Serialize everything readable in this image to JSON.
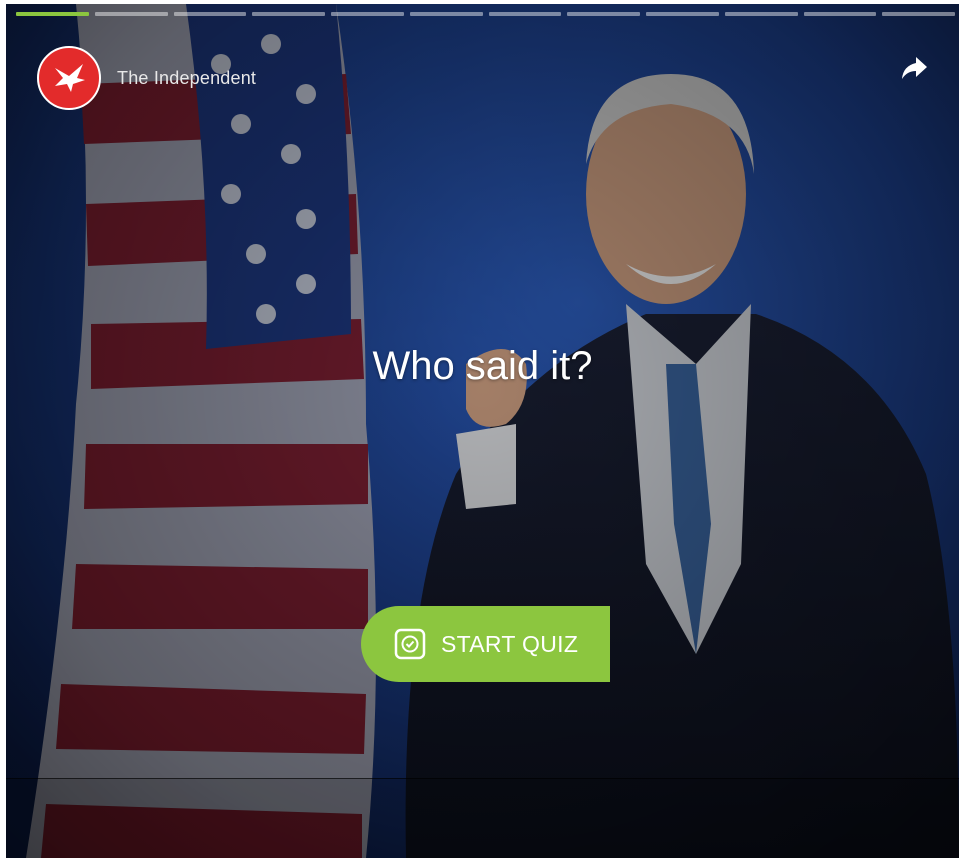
{
  "story": {
    "publisher": "The Independent",
    "title": "Who said it?",
    "start_button_label": "START QUIZ",
    "progress": {
      "total_segments": 12,
      "active_segment": 1
    }
  },
  "icons": {
    "logo": "eagle-logo-icon",
    "share": "share-arrow-icon",
    "quiz": "quiz-check-icon"
  },
  "colors": {
    "accent": "#8cc63f",
    "logo_red": "#e32b2b",
    "background_blue": "#1c3f93"
  }
}
